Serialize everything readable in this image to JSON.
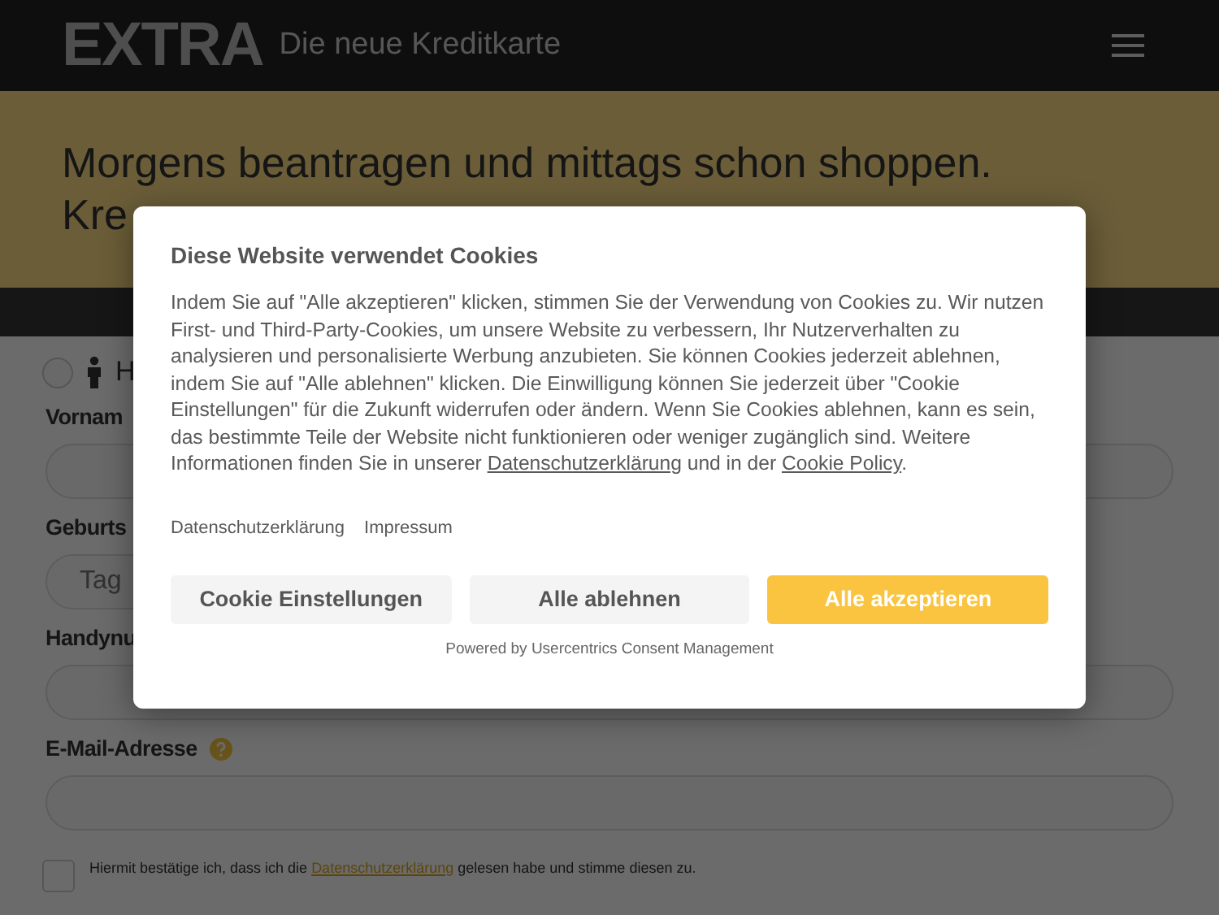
{
  "header": {
    "logo": "EXTRA",
    "tagline": "Die neue Kreditkarte"
  },
  "hero": {
    "lines": [
      "Morgens beantragen und mittags schon shoppen.",
      "Kre"
    ]
  },
  "form": {
    "gender_option": {
      "label": "H",
      "selected": false
    },
    "fields": [
      {
        "label": "Vornam",
        "kind": "wide"
      },
      {
        "label": "Geburts",
        "kind": "short",
        "placeholder": "Tag"
      },
      {
        "label": "Handynu",
        "kind": "wide"
      },
      {
        "label": "E-Mail-Adresse",
        "kind": "wide",
        "help": true
      }
    ],
    "consent": {
      "before": "Hiermit bestätige ich, dass ich die",
      "link": "Datenschutzerklärung",
      "after": "gelesen habe und stimme diesen zu.",
      "checked": false
    }
  },
  "cookie_dialog": {
    "title": "Diese Website verwendet Cookies",
    "body": "Indem Sie auf \"Alle akzeptieren\" klicken, stimmen Sie der Verwendung von Cookies zu. Wir nutzen First- und Third-Party-Cookies, um unsere Website zu verbessern, Ihr Nutzerverhalten zu analysieren und personalisierte Werbung anzubieten. Sie können Cookies jederzeit ablehnen, indem Sie auf \"Alle ablehnen\" klicken. Die Einwilligung können Sie jederzeit über \"Cookie Einstellungen\" für die Zukunft widerrufen oder ändern. Wenn Sie Cookies ablehnen, kann es sein, das bestimmte Teile der Website nicht funktionieren oder weniger zugänglich sind. Weitere Informationen finden Sie in unserer",
    "body_link_1": "Datenschutzerklärung",
    "body_middle": "und in der",
    "body_link_2": "Cookie Policy",
    "body_end": ".",
    "links": [
      "Datenschutzerklärung",
      "Impressum"
    ],
    "buttons": [
      {
        "label": "Cookie Einstellungen",
        "kind": "secondary"
      },
      {
        "label": "Alle ablehnen",
        "kind": "secondary"
      },
      {
        "label": "Alle akzeptieren",
        "kind": "primary"
      }
    ],
    "powered_by": "Powered by Usercentrics Consent Management"
  }
}
